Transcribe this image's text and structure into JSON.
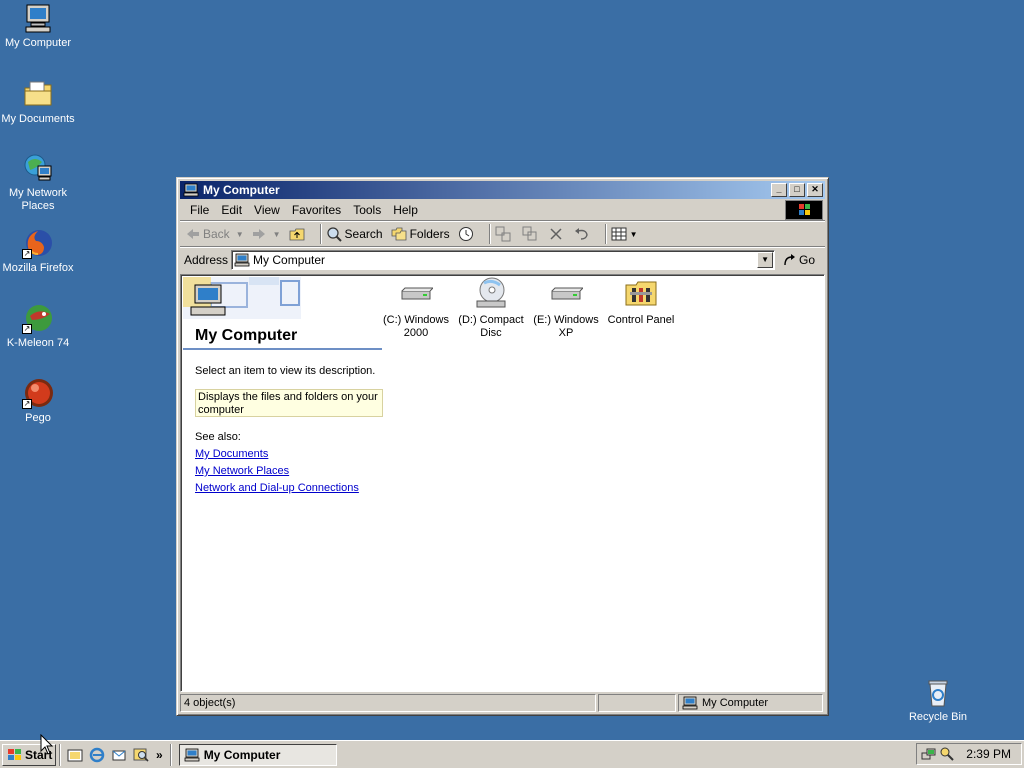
{
  "desktop": {
    "icons": [
      {
        "label": "My Computer"
      },
      {
        "label": "My Documents"
      },
      {
        "label": "My Network Places"
      },
      {
        "label": "Mozilla Firefox"
      },
      {
        "label": "K-Meleon 74"
      },
      {
        "label": "Pego"
      }
    ],
    "recycle_bin": "Recycle Bin"
  },
  "window": {
    "title": "My Computer",
    "menu": [
      "File",
      "Edit",
      "View",
      "Favorites",
      "Tools",
      "Help"
    ],
    "toolbar": {
      "back": "Back",
      "search": "Search",
      "folders": "Folders"
    },
    "address": {
      "label": "Address",
      "value": "My Computer",
      "go": "Go"
    },
    "left_pane": {
      "title": "My Computer",
      "prompt": "Select an item to view its description.",
      "description": "Displays the files and folders on your computer",
      "see_also": "See also:",
      "links": [
        "My Documents",
        "My Network Places",
        "Network and Dial-up Connections"
      ]
    },
    "items": [
      {
        "line1": "(C:) Windows",
        "line2": "2000"
      },
      {
        "line1": "(D:) Compact",
        "line2": "Disc"
      },
      {
        "line1": "(E:) Windows",
        "line2": "XP"
      },
      {
        "line1": "Control Panel",
        "line2": ""
      }
    ],
    "status": {
      "objects": "4 object(s)",
      "zone": "My Computer"
    }
  },
  "taskbar": {
    "start": "Start",
    "task": "My Computer",
    "clock": "2:39 PM"
  },
  "colors": {
    "desktop": "#3a6ea5",
    "titlebar": "#0a246a",
    "face": "#d4d0c8",
    "link": "#0000cc"
  }
}
